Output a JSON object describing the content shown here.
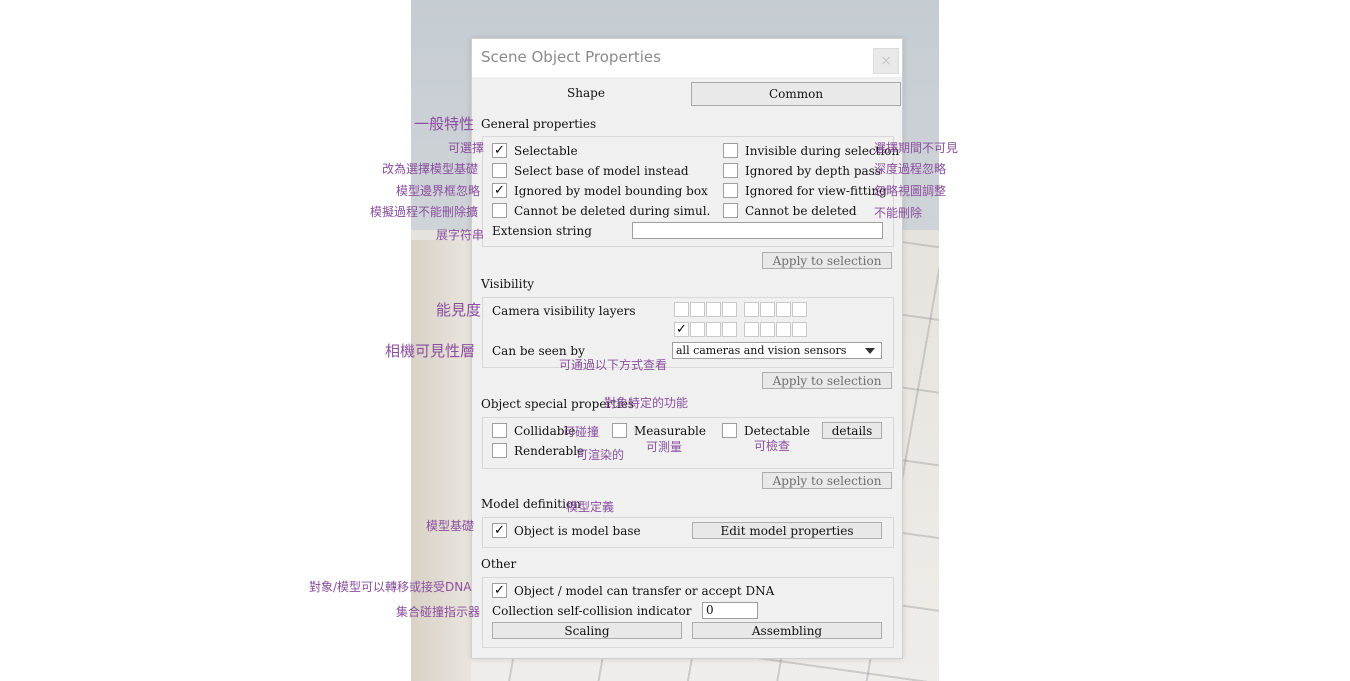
{
  "dialog": {
    "title": "Scene Object Properties",
    "close_label": "×"
  },
  "tabs": [
    {
      "label": "Shape"
    },
    {
      "label": "Common"
    }
  ],
  "general": {
    "heading": "General properties",
    "left": [
      {
        "label": "Selectable",
        "checked": true
      },
      {
        "label": "Select base of model instead",
        "checked": false
      },
      {
        "label": "Ignored by model bounding  box",
        "checked": true
      },
      {
        "label": "Cannot be deleted during simul.",
        "checked": false
      }
    ],
    "right": [
      {
        "label": "Invisible during selection",
        "checked": false
      },
      {
        "label": "Ignored by depth pass",
        "checked": false
      },
      {
        "label": "Ignored for view-fitting",
        "checked": false
      },
      {
        "label": "Cannot be deleted",
        "checked": false
      }
    ],
    "extension_label": "Extension string",
    "extension_value": "",
    "apply_label": "Apply to selection"
  },
  "visibility": {
    "heading": "Visibility",
    "layers_label": "Camera visibility layers",
    "layers_row1": [
      false,
      false,
      false,
      false,
      false,
      false,
      false,
      false
    ],
    "layers_row2": [
      true,
      false,
      false,
      false,
      false,
      false,
      false,
      false
    ],
    "seen_by_label": "Can be seen by",
    "seen_by_value": "all cameras and vision sensors",
    "apply_label": "Apply to selection"
  },
  "special": {
    "heading": "Object special properties",
    "collidable": {
      "label": "Collidable",
      "checked": false
    },
    "measurable": {
      "label": "Measurable",
      "checked": false
    },
    "detectable": {
      "label": "Detectable",
      "checked": false
    },
    "renderable": {
      "label": "Renderable",
      "checked": false
    },
    "details_label": "details",
    "apply_label": "Apply to selection"
  },
  "model": {
    "heading": "Model definition",
    "is_base": {
      "label": "Object is model base",
      "checked": true
    },
    "edit_label": "Edit model properties"
  },
  "other": {
    "heading": "Other",
    "dna": {
      "label": "Object / model can transfer or accept DNA",
      "checked": true
    },
    "collision_label": "Collection self-collision indicator",
    "collision_value": "0",
    "scaling_label": "Scaling",
    "assembling_label": "Assembling"
  },
  "annotations": {
    "general": "一般特性",
    "selectable": "可選擇",
    "select_base": "改為選擇模型基礎",
    "ignored_bbox": "模型邊界框忽略",
    "cannot_delete_sim": "模擬過程不能刪除擴",
    "extension": "展字符串",
    "invisible": "選擇期間不可見",
    "depth": "深度過程忽略",
    "view_fit": "忽略視圖調整",
    "cannot_delete": "不能刪除",
    "visibility": "能見度",
    "camera_layers": "相機可見性層",
    "seen_by": "可通過以下方式查看",
    "special": "對象特定的功能",
    "collidable": "可碰撞",
    "measurable": "可測量",
    "detectable": "可檢查",
    "renderable": "可渲染的",
    "model_def": "模型定義",
    "model_base": "模型基礎",
    "dna": "對象/模型可以轉移或接受DNA",
    "collision": "集合碰撞指示器"
  },
  "check_glyph": "✓"
}
